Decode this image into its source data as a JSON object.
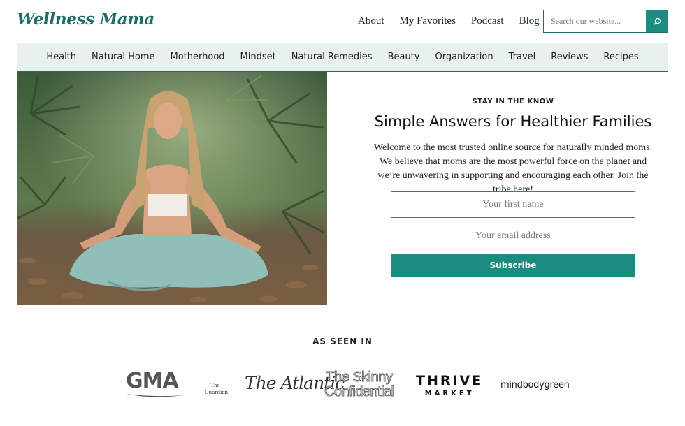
{
  "header": {
    "logo_text": "Wellness Mama",
    "nav": [
      "About",
      "My Favorites",
      "Podcast",
      "Blog"
    ],
    "search": {
      "placeholder": "Search our website...",
      "icon": "search-icon"
    }
  },
  "category_nav": [
    "Health",
    "Natural Home",
    "Motherhood",
    "Mindset",
    "Natural Remedies",
    "Beauty",
    "Organization",
    "Travel",
    "Reviews",
    "Recipes"
  ],
  "hero": {
    "eyebrow": "STAY IN THE KNOW",
    "headline": "Simple Answers for Healthier Families",
    "blurb": "Welcome to the most trusted online source for naturally minded moms. We believe that moms are the most powerful force on the planet and we’re unwavering in supporting and encouraging each other. Join the tribe here!",
    "first_name_placeholder": "Your first name",
    "email_placeholder": "Your email address",
    "subscribe_label": "Subscribe"
  },
  "as_seen_in": {
    "title": "AS SEEN IN",
    "logos": {
      "gma": "GMA",
      "guardian": "The Guardian",
      "atlantic": "The Atlantic",
      "skinny_line1": "The Skinny",
      "skinny_line2": "Confidential",
      "thrive_line1": "THRIVE",
      "thrive_line2": "MARKET",
      "mbg": "mindbodygreen"
    }
  },
  "colors": {
    "brand": "#1b6f66",
    "accent": "#1b8c80",
    "nav_bg": "#e9f1ef"
  }
}
